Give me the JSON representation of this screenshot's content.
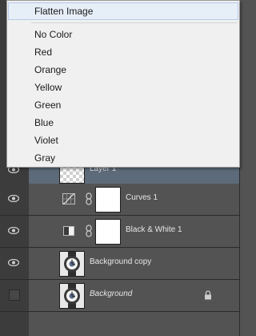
{
  "menu": {
    "items": [
      {
        "label": "Flatten Image",
        "highlighted": true
      },
      {
        "label": "No Color"
      },
      {
        "label": "Red"
      },
      {
        "label": "Orange"
      },
      {
        "label": "Yellow"
      },
      {
        "label": "Green"
      },
      {
        "label": "Blue"
      },
      {
        "label": "Violet"
      },
      {
        "label": "Gray"
      }
    ]
  },
  "layers": [
    {
      "name": "Layer 1",
      "visible": true,
      "selected": true,
      "thumbnail": "transparent"
    },
    {
      "name": "Curves 1",
      "visible": true,
      "adjustment": "curves-icon",
      "mask": true
    },
    {
      "name": "Black & White 1",
      "visible": true,
      "adjustment": "black-white-icon",
      "mask": true
    },
    {
      "name": "Background copy",
      "visible": true,
      "thumbnail": "watch"
    },
    {
      "name": "Background",
      "visible": false,
      "thumbnail": "watch",
      "locked": true
    }
  ],
  "colors": {
    "panel_bg": "#535353",
    "selected_row": "#5d6a7a",
    "menu_bg": "#f0f0f0",
    "menu_highlight": "#e6eef8"
  }
}
